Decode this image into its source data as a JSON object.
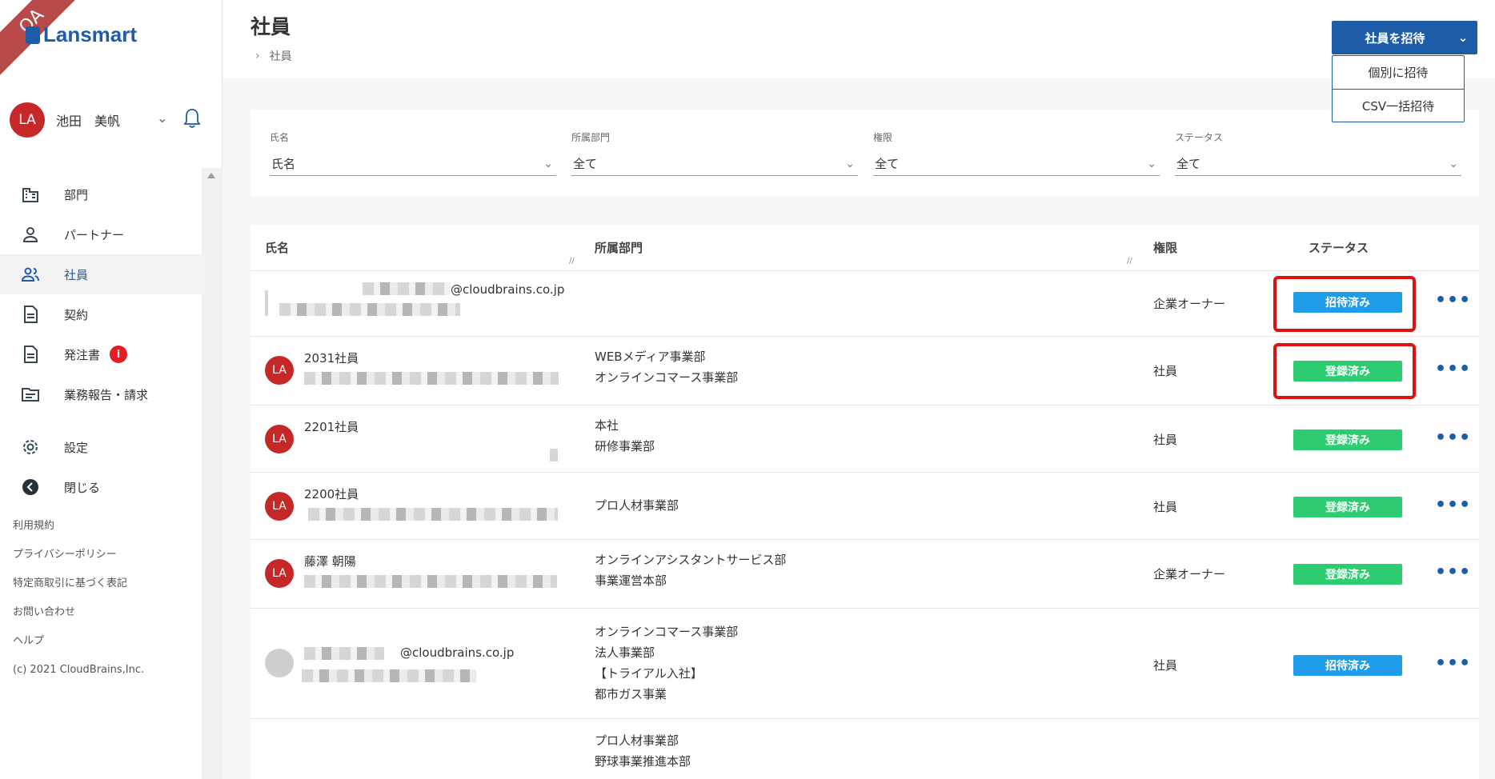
{
  "sidebar": {
    "ribbon": "QA",
    "logo": "Lansmart",
    "user": {
      "initials": "LA",
      "name": "池田　美帆"
    },
    "nav": [
      {
        "label": "部門",
        "icon": "building-icon"
      },
      {
        "label": "パートナー",
        "icon": "person-icon"
      },
      {
        "label": "社員",
        "icon": "people-icon",
        "active": true
      },
      {
        "label": "契約",
        "icon": "document-icon"
      },
      {
        "label": "発注書",
        "icon": "document-icon",
        "badge": "i"
      },
      {
        "label": "業務報告・請求",
        "icon": "folder-icon"
      },
      {
        "label": "設定",
        "icon": "gear-icon"
      },
      {
        "label": "閉じる",
        "icon": "back-arrow-icon"
      }
    ],
    "footer": [
      "利用規約",
      "プライバシーポリシー",
      "特定商取引に基づく表記",
      "お問い合わせ",
      "ヘルプ",
      "(c) 2021 CloudBrains,Inc."
    ]
  },
  "header": {
    "title": "社員",
    "breadcrumb": "社員",
    "invite_button": "社員を招待",
    "invite_menu": [
      "個別に招待",
      "CSV一括招待"
    ]
  },
  "filters": [
    {
      "label": "氏名",
      "value": "氏名"
    },
    {
      "label": "所属部門",
      "value": "全て"
    },
    {
      "label": "権限",
      "value": "全て"
    },
    {
      "label": "ステータス",
      "value": "全て"
    }
  ],
  "table": {
    "columns": [
      "氏名",
      "所属部門",
      "権限",
      "ステータス"
    ],
    "rows": [
      {
        "name": "",
        "email_suffix": "@cloudbrains.co.jp",
        "depts": [],
        "role": "企業オーナー",
        "status": "招待済み",
        "status_type": "invited",
        "highlighted": true
      },
      {
        "name": "2031社員",
        "depts": [
          "WEBメディア事業部",
          "オンラインコマース事業部"
        ],
        "role": "社員",
        "status": "登録済み",
        "status_type": "registered",
        "highlighted": true,
        "avatar": "LA"
      },
      {
        "name": "2201社員",
        "depts": [
          "本社",
          "研修事業部"
        ],
        "role": "社員",
        "status": "登録済み",
        "status_type": "registered",
        "avatar": "LA"
      },
      {
        "name": "2200社員",
        "depts": [
          "プロ人材事業部"
        ],
        "role": "社員",
        "status": "登録済み",
        "status_type": "registered",
        "avatar": "LA"
      },
      {
        "name": "藤澤 朝陽",
        "depts": [
          "オンラインアシスタントサービス部",
          "事業運営本部"
        ],
        "role": "企業オーナー",
        "status": "登録済み",
        "status_type": "registered",
        "avatar": "LA"
      },
      {
        "name": "",
        "email_suffix": "@cloudbrains.co.jp",
        "depts": [
          "オンラインコマース事業部",
          "法人事業部",
          "【トライアル入社】",
          "都市ガス事業"
        ],
        "role": "社員",
        "status": "招待済み",
        "status_type": "invited"
      },
      {
        "name": "",
        "depts": [
          "プロ人材事業部",
          "野球事業推進本部"
        ],
        "role": "",
        "status": ""
      }
    ]
  }
}
